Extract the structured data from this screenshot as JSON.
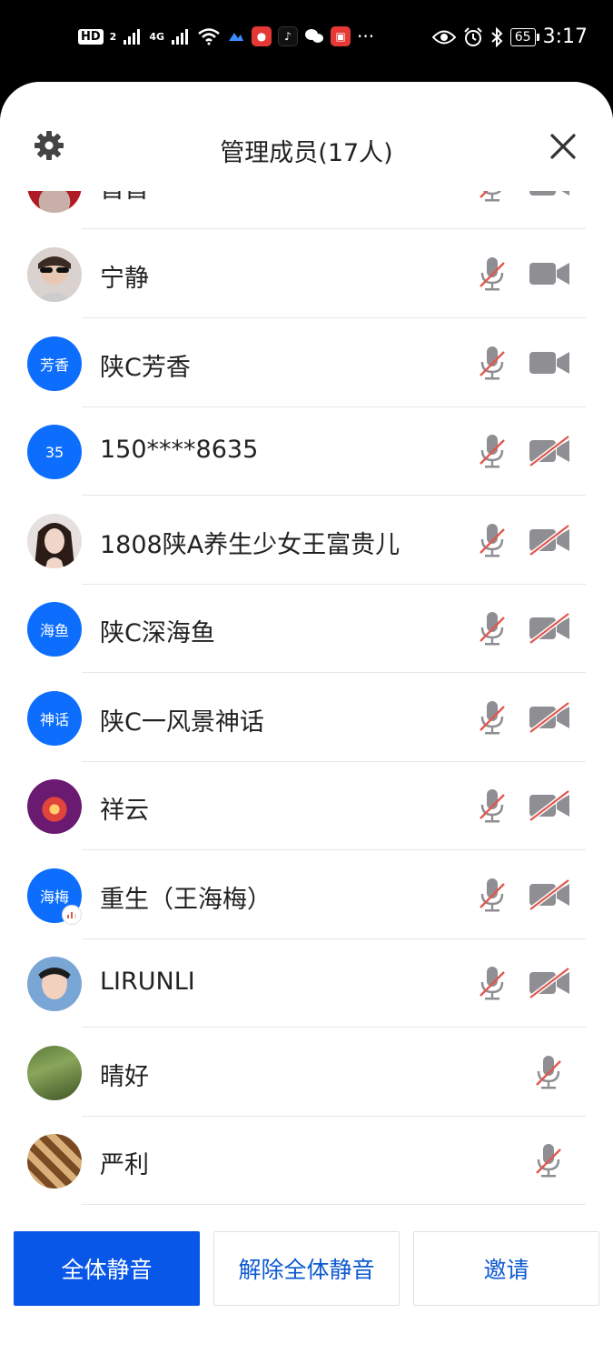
{
  "status_bar": {
    "hd": "HD",
    "sim": "2",
    "net": "4G",
    "more": "···",
    "battery": "65",
    "time": "3:17"
  },
  "header": {
    "title": "管理成员(17人)"
  },
  "members": [
    {
      "name": "首首",
      "avatar": "photo-red",
      "mic": "muted",
      "cam": "on"
    },
    {
      "name": "宁静",
      "avatar": "photo-sunglasses",
      "mic": "muted",
      "cam": "on"
    },
    {
      "name": "陕C芳香",
      "avatar_text": "芳香",
      "mic": "muted",
      "cam": "on"
    },
    {
      "name": "150****8635",
      "avatar_text": "35",
      "mic": "muted",
      "cam": "off"
    },
    {
      "name": "1808陕A养生少女王富贵儿",
      "avatar": "photo-girl",
      "mic": "muted",
      "cam": "off"
    },
    {
      "name": "陕C深海鱼",
      "avatar_text": "海鱼",
      "mic": "muted",
      "cam": "off"
    },
    {
      "name": "陕C一风景神话",
      "avatar_text": "神话",
      "mic": "muted",
      "cam": "off"
    },
    {
      "name": "祥云",
      "avatar": "photo-candle",
      "mic": "muted",
      "cam": "off"
    },
    {
      "name": "重生（王海梅）",
      "avatar_text": "海梅",
      "mic": "muted",
      "cam": "off",
      "speaking": true
    },
    {
      "name": "LIRUNLI",
      "avatar": "photo-face",
      "mic": "muted",
      "cam": "off"
    },
    {
      "name": "晴好",
      "avatar": "photo-garden",
      "mic": "muted"
    },
    {
      "name": "严利",
      "avatar": "photo-chess",
      "mic": "muted"
    }
  ],
  "footer": {
    "mute_all": "全体静音",
    "unmute_all": "解除全体静音",
    "invite": "邀请"
  },
  "colors": {
    "primary": "#0957e8",
    "avatar_blue": "#0d6efd",
    "muted_slash": "#e0584f",
    "icon_gray": "#8e8e93"
  }
}
